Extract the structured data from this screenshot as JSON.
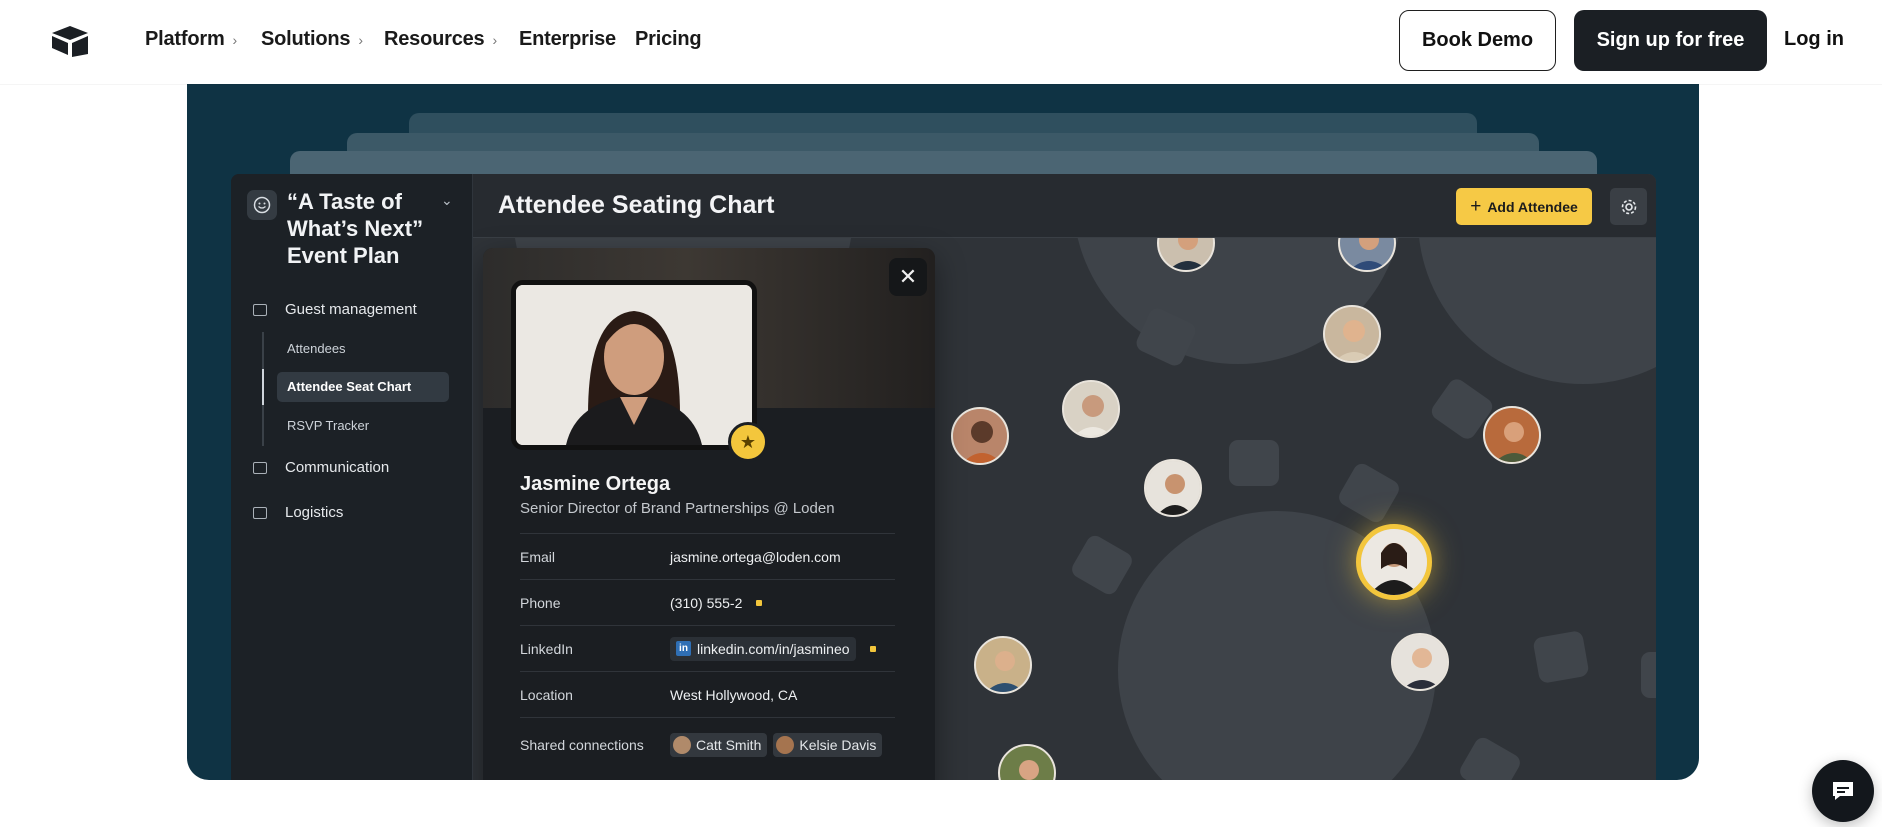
{
  "nav": {
    "items": [
      {
        "label": "Platform",
        "has_chevron": true
      },
      {
        "label": "Solutions",
        "has_chevron": true
      },
      {
        "label": "Resources",
        "has_chevron": true
      },
      {
        "label": "Enterprise",
        "has_chevron": false
      },
      {
        "label": "Pricing",
        "has_chevron": false
      }
    ],
    "chevron": "›",
    "book_demo": "Book Demo",
    "signup": "Sign up for free",
    "login": "Log in"
  },
  "app": {
    "sidebar": {
      "title": "“A Taste of What’s Next” Event Plan",
      "groups": [
        {
          "label": "Guest management",
          "subitems": [
            "Attendees",
            "Attendee Seat Chart",
            "RSVP Tracker"
          ]
        },
        {
          "label": "Communication"
        },
        {
          "label": "Logistics"
        }
      ],
      "active_subitem": "Attendee Seat Chart"
    },
    "header": {
      "title": "Attendee Seating Chart",
      "add_button": "Add Attendee"
    },
    "profile": {
      "name": "Jasmine Ortega",
      "role": "Senior Director of Brand Partnerships @ Loden",
      "fields": [
        {
          "label": "Email",
          "value": "jasmine.ortega@loden.com"
        },
        {
          "label": "Phone",
          "value": "(310) 555-2"
        },
        {
          "label": "LinkedIn",
          "value": "linkedin.com/in/jasmineo"
        },
        {
          "label": "Location",
          "value": "West Hollywood, CA"
        },
        {
          "label": "Shared connections",
          "chips": [
            "Catt Smith",
            "Kelsie Davis"
          ]
        }
      ],
      "linkedin_badge": "in"
    }
  },
  "colors": {
    "hero_bg": "#0f3344",
    "accent_yellow": "#f3c63c",
    "signup_bg": "#1b1f24"
  },
  "icons": [
    "logo-icon",
    "chevron-right-icon",
    "smiley-icon",
    "chevron-down-icon",
    "chat-icon",
    "gear-icon",
    "close-icon",
    "star-icon",
    "linkedin-icon"
  ]
}
